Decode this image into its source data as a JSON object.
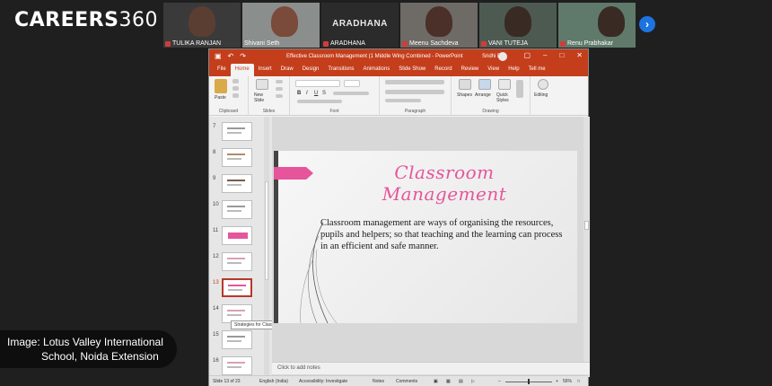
{
  "brand": {
    "name": "CAREERS",
    "num": "360"
  },
  "participants": [
    {
      "name": "TULIKA RANJAN",
      "type": "video"
    },
    {
      "name": "Shivani Seth",
      "type": "video"
    },
    {
      "name": "ARADHANA",
      "type": "text",
      "big": "ARADHANA"
    },
    {
      "name": "Meenu Sachdeva",
      "type": "video"
    },
    {
      "name": "VANI TUTEJA",
      "type": "video"
    },
    {
      "name": "Renu Prabhakar",
      "type": "video"
    }
  ],
  "ppt": {
    "title": "Effective Classroom Management (1 Middle Wing Combined - PowerPoint",
    "user": "Sridhi B",
    "tabs": [
      "File",
      "Home",
      "Insert",
      "Draw",
      "Design",
      "Transitions",
      "Animations",
      "Slide Show",
      "Record",
      "Review",
      "View",
      "Help",
      "Tell me"
    ],
    "active_tab": "Home",
    "ribbon": {
      "paste": "Paste",
      "clipboard": "Clipboard",
      "new_slide": "New Slide",
      "slides": "Slides",
      "font": "Font",
      "paragraph": "Paragraph",
      "shapes": "Shapes",
      "arrange": "Arrange",
      "quick_styles": "Quick Styles",
      "drawing": "Drawing",
      "editing": "Editing"
    },
    "thumb_numbers": [
      "7",
      "8",
      "9",
      "10",
      "11",
      "12",
      "13",
      "14",
      "15",
      "16"
    ],
    "selected_thumb": "13",
    "tooltip": "Strategies for Classroom Manage...",
    "slide": {
      "title": "Classroom Management",
      "body": "Classroom management are ways of organising the resources, pupils and helpers; so that teaching and the learning can process in an efficient and safe manner."
    },
    "notes_placeholder": "Click to add notes",
    "status": {
      "slide_count": "Slide 13 of 23",
      "language": "English (India)",
      "accessibility": "Accessibility: Investigate",
      "notes": "Notes",
      "comments": "Comments",
      "zoom": "56%"
    }
  },
  "caption": {
    "line1": "Image: Lotus Valley International",
    "line2": "School, Noida Extension"
  },
  "colors": {
    "ppt_red": "#c43e1c",
    "slide_pink": "#e6559b",
    "zoom_blue": "#1d74e0"
  }
}
